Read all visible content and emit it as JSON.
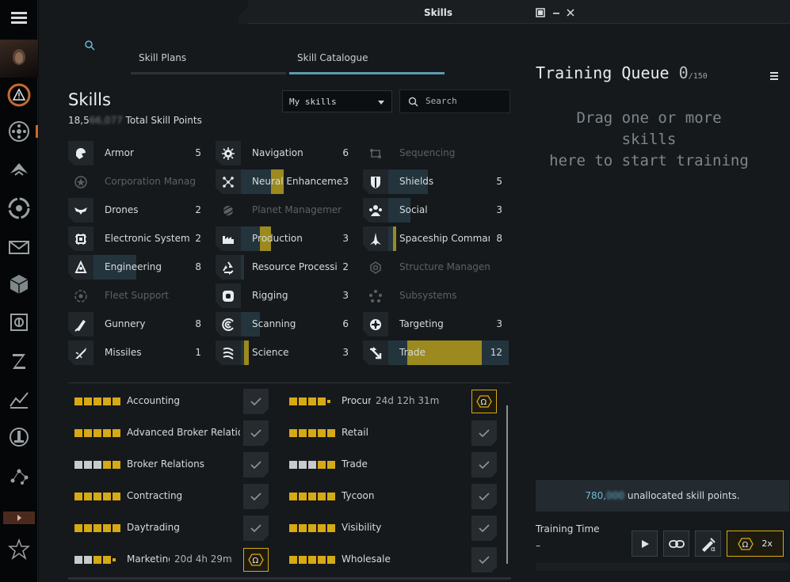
{
  "window": {
    "title": "Skills"
  },
  "tabs": [
    {
      "label": "Skill Plans",
      "active": false
    },
    {
      "label": "Skill Catalogue",
      "active": true
    }
  ],
  "catalogue": {
    "heading": "Skills",
    "total_sp_prefix": "18,5",
    "total_sp_blurred": "66,077",
    "total_sp_suffix": "Total Skill Points",
    "filter_selected": "My skills",
    "search_placeholder": "Search"
  },
  "categories": [
    {
      "name": "Armor",
      "level": "5",
      "icon": "armor-icon",
      "dim": false
    },
    {
      "name": "Corporation Manag",
      "level": "",
      "icon": "corporation-icon",
      "dim": true
    },
    {
      "name": "Drones",
      "level": "2",
      "icon": "drone-icon",
      "dim": false
    },
    {
      "name": "Electronic System",
      "level": "2",
      "icon": "chip-icon",
      "dim": false
    },
    {
      "name": "Engineering",
      "level": "8",
      "icon": "engineering-icon",
      "dim": false
    },
    {
      "name": "Fleet Support",
      "level": "",
      "icon": "fleet-icon",
      "dim": true
    },
    {
      "name": "Gunnery",
      "level": "8",
      "icon": "gun-icon",
      "dim": false
    },
    {
      "name": "Missiles",
      "level": "1",
      "icon": "missile-icon",
      "dim": false
    },
    {
      "name": "Navigation",
      "level": "6",
      "icon": "navigation-icon",
      "dim": false
    },
    {
      "name": "Neural Enhanceme",
      "level": "3",
      "icon": "neural-icon",
      "dim": false
    },
    {
      "name": "Planet Managemer",
      "level": "",
      "icon": "planet-icon",
      "dim": true
    },
    {
      "name": "Production",
      "level": "3",
      "icon": "factory-icon",
      "dim": false
    },
    {
      "name": "Resource Processi",
      "level": "2",
      "icon": "recycle-icon",
      "dim": false
    },
    {
      "name": "Rigging",
      "level": "3",
      "icon": "rigging-icon",
      "dim": false
    },
    {
      "name": "Scanning",
      "level": "6",
      "icon": "scanning-icon",
      "dim": false
    },
    {
      "name": "Science",
      "level": "3",
      "icon": "science-icon",
      "dim": false
    },
    {
      "name": "Sequencing",
      "level": "",
      "icon": "sequencing-icon",
      "dim": true
    },
    {
      "name": "Shields",
      "level": "5",
      "icon": "shield-icon",
      "dim": false
    },
    {
      "name": "Social",
      "level": "3",
      "icon": "social-icon",
      "dim": false
    },
    {
      "name": "Spaceship Command",
      "level": "8",
      "icon": "spaceship-icon",
      "dim": false
    },
    {
      "name": "Structure Managem",
      "level": "",
      "icon": "structure-icon",
      "dim": true
    },
    {
      "name": "Subsystems",
      "level": "",
      "icon": "subsystems-icon",
      "dim": true
    },
    {
      "name": "Targeting",
      "level": "3",
      "icon": "target-icon",
      "dim": false
    },
    {
      "name": "Trade",
      "level": "12",
      "icon": "trade-icon",
      "dim": false,
      "selected": true
    }
  ],
  "skills_left": [
    {
      "name": "Accounting",
      "pips": "ggggg",
      "time": "",
      "state": "check"
    },
    {
      "name": "Advanced Broker Relatio",
      "pips": "ggggg",
      "time": "",
      "state": "check"
    },
    {
      "name": "Broker Relations",
      "pips": "wwwgg",
      "time": "",
      "state": "check"
    },
    {
      "name": "Contracting",
      "pips": "ggggg",
      "time": "",
      "state": "check"
    },
    {
      "name": "Daytrading",
      "pips": "ggggg",
      "time": "",
      "state": "check"
    },
    {
      "name": "Marketing",
      "pips": "wwgg.",
      "time": "20d 4h 29m",
      "state": "omega"
    }
  ],
  "skills_right": [
    {
      "name": "Procureme",
      "pips": "gggg.",
      "time": "24d 12h 31m",
      "state": "omega"
    },
    {
      "name": "Retail",
      "pips": "ggggg",
      "time": "",
      "state": "check"
    },
    {
      "name": "Trade",
      "pips": "wwwgg",
      "time": "",
      "state": "check"
    },
    {
      "name": "Tycoon",
      "pips": "ggggg",
      "time": "",
      "state": "check"
    },
    {
      "name": "Visibility",
      "pips": "ggggg",
      "time": "",
      "state": "check"
    },
    {
      "name": "Wholesale",
      "pips": "ggggg",
      "time": "",
      "state": "check"
    }
  ],
  "queue": {
    "title": "Training Queue",
    "count": "0",
    "max": "/150",
    "empty_line1": "Drag one or more skills",
    "empty_line2": "here to start training",
    "unallocated_prefix": "780,",
    "unallocated_blurred": "000",
    "unallocated_suffix": "unallocated skill points.",
    "training_time_label": "Training Time",
    "training_time_value": "–",
    "boost_label": "2x"
  },
  "colors": {
    "gold": "#d7a915",
    "accent": "#5b9ab0",
    "bg": "#15191c"
  }
}
